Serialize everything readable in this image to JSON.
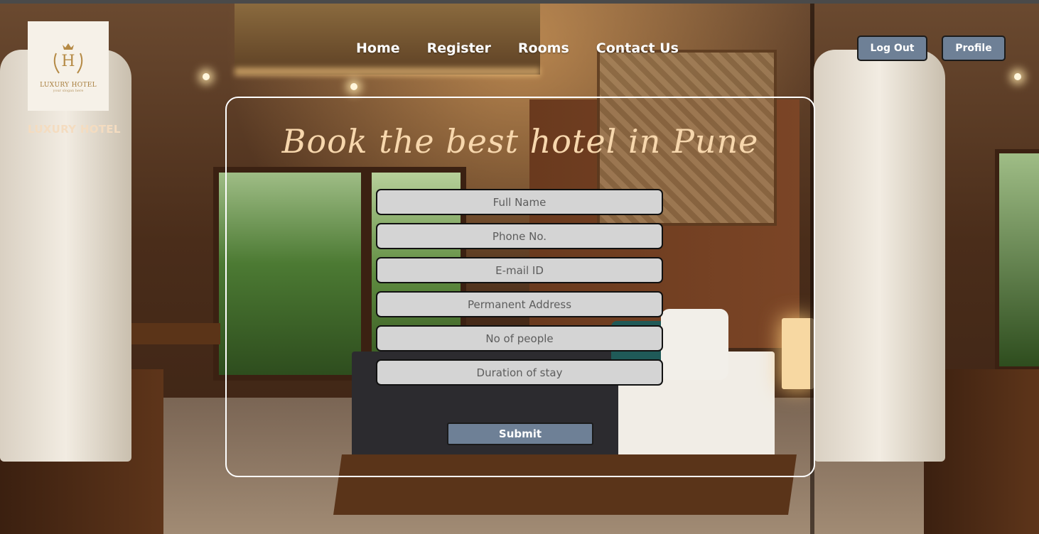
{
  "brand": {
    "logo_title": "LUXURY HOTEL",
    "logo_tagline": "your slogan here",
    "logo_letter": "H",
    "name": "LUXURY HOTEL"
  },
  "nav": {
    "items": [
      {
        "label": "Home"
      },
      {
        "label": "Register"
      },
      {
        "label": "Rooms"
      },
      {
        "label": "Contact Us"
      }
    ]
  },
  "header_buttons": {
    "logout_label": "Log Out",
    "profile_label": "Profile"
  },
  "form": {
    "title": "Book the best hotel in Pune",
    "fields": [
      {
        "placeholder": "Full Name",
        "value": ""
      },
      {
        "placeholder": "Phone No.",
        "value": ""
      },
      {
        "placeholder": "E-mail ID",
        "value": ""
      },
      {
        "placeholder": "Permanent Address",
        "value": ""
      },
      {
        "placeholder": "No of people",
        "value": ""
      },
      {
        "placeholder": "Duration of stay",
        "value": ""
      }
    ],
    "submit_label": "Submit"
  },
  "colors": {
    "button_bg": "#6e8096",
    "title_color": "#f7d7ad",
    "field_bg": "#d4d4d4",
    "logo_gold": "#a77d3c"
  }
}
